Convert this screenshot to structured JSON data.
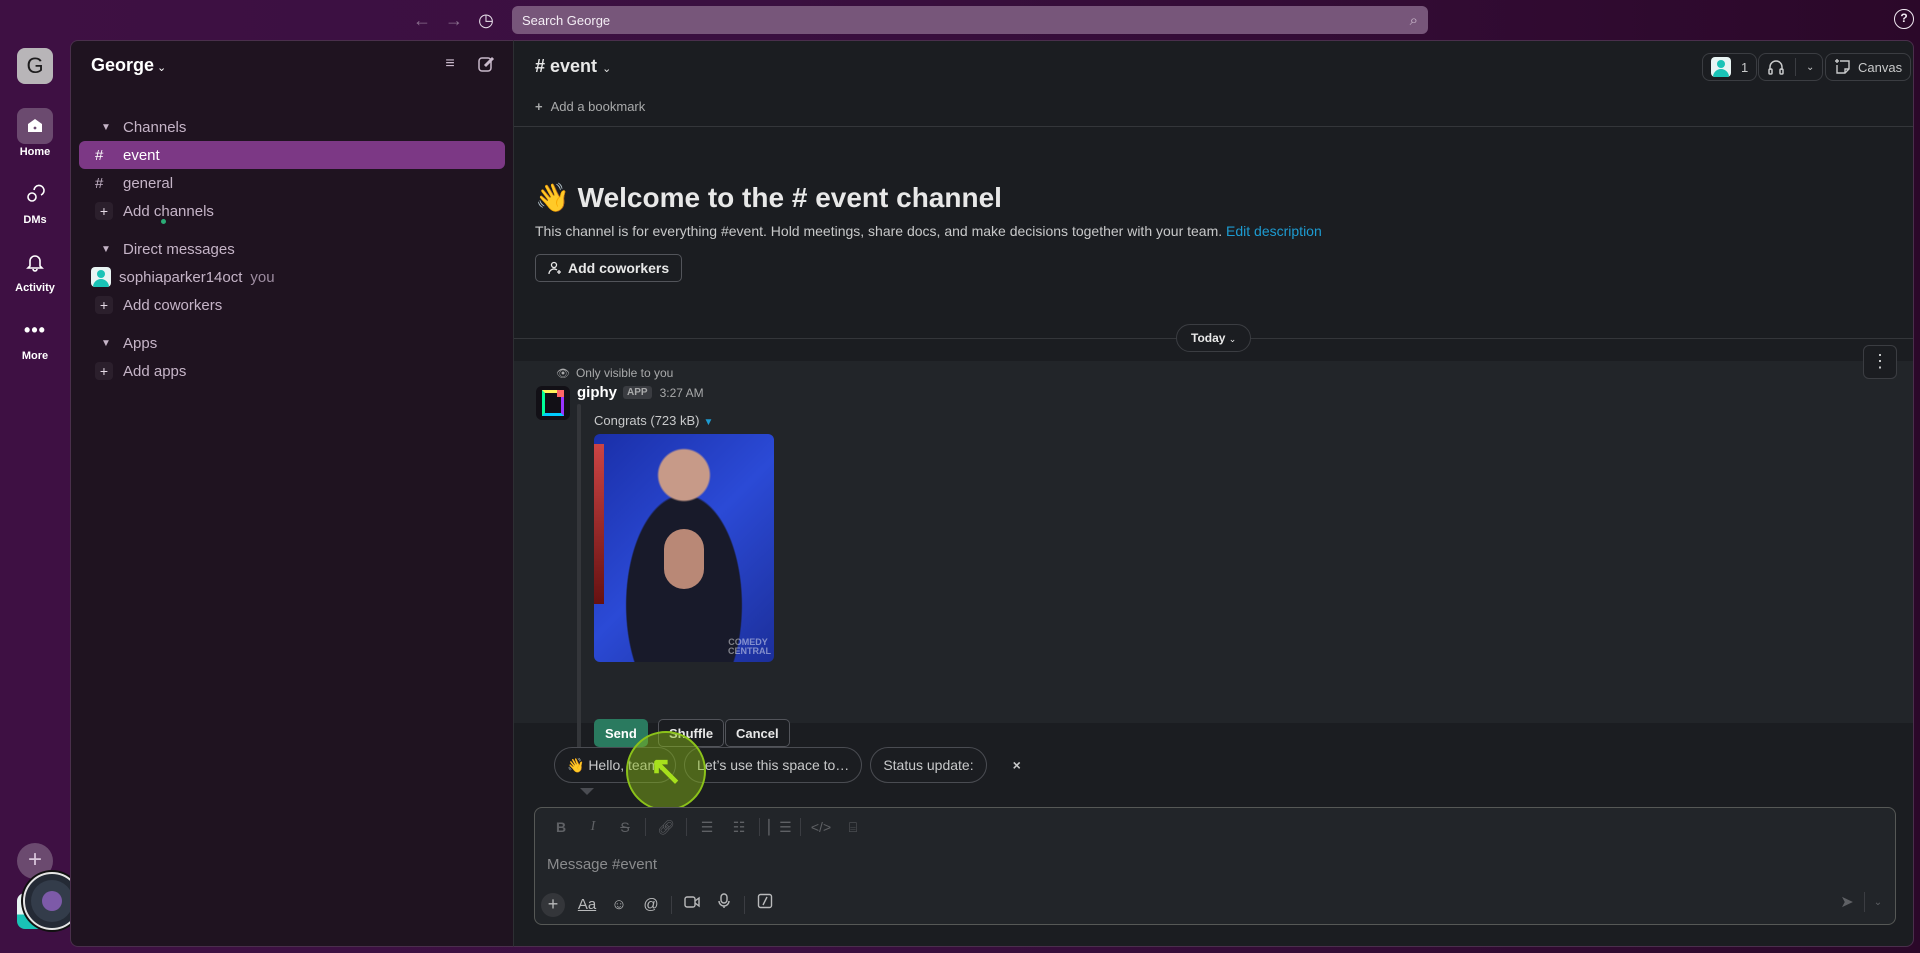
{
  "topbar": {
    "search_placeholder": "Search George",
    "back_icon": "←",
    "forward_icon": "→",
    "history_icon": "◷",
    "search_icon": "⌕",
    "help_icon": "?"
  },
  "rail": {
    "workspace_initial": "G",
    "items": [
      {
        "label": "Home",
        "icon": "home-icon",
        "active": true
      },
      {
        "label": "DMs",
        "icon": "dms-icon",
        "active": false
      },
      {
        "label": "Activity",
        "icon": "bell-icon",
        "active": false
      },
      {
        "label": "More",
        "icon": "more-icon",
        "active": false
      }
    ],
    "add_label": "+"
  },
  "sidebar": {
    "workspace_name": "George",
    "sections": {
      "channels": {
        "label": "Channels",
        "items": [
          {
            "name": "event",
            "active": true
          },
          {
            "name": "general",
            "active": false
          }
        ],
        "add_label": "Add channels"
      },
      "dms": {
        "label": "Direct messages",
        "user": "sophiaparker14oct",
        "you_label": "you",
        "add_label": "Add coworkers"
      },
      "apps": {
        "label": "Apps",
        "add_label": "Add apps"
      }
    }
  },
  "channel": {
    "title": "event",
    "bookmark_label": "Add a bookmark",
    "member_count": "1",
    "canvas_label": "Canvas",
    "welcome_emoji": "👋",
    "welcome_title": "Welcome to the # event channel",
    "description": "This channel is for everything #event. Hold meetings, share docs, and make decisions together with your team.",
    "edit_description_label": "Edit description",
    "add_coworkers_label": "Add coworkers",
    "date_divider": "Today"
  },
  "message": {
    "visibility_note": "Only visible to you",
    "author": "giphy",
    "badge": "APP",
    "time": "3:27 AM",
    "attachment_title": "Congrats (723 kB)",
    "gif_watermark": "COMEDY CENTRAL",
    "actions": {
      "send": "Send",
      "shuffle": "Shuffle",
      "cancel": "Cancel"
    }
  },
  "suggestions": {
    "chips": [
      "👋 Hello, team!",
      "Let’s use this space to…",
      "Status update:"
    ],
    "close_icon": "×"
  },
  "composer": {
    "placeholder": "Message #event",
    "format_buttons": [
      "B",
      "I",
      "S"
    ],
    "text_button": "Aa"
  },
  "colors": {
    "accent_selected": "#7c3885",
    "send_green": "#2a7a5f",
    "link_blue": "#1d9bd1",
    "presence_green": "#2bac76"
  }
}
